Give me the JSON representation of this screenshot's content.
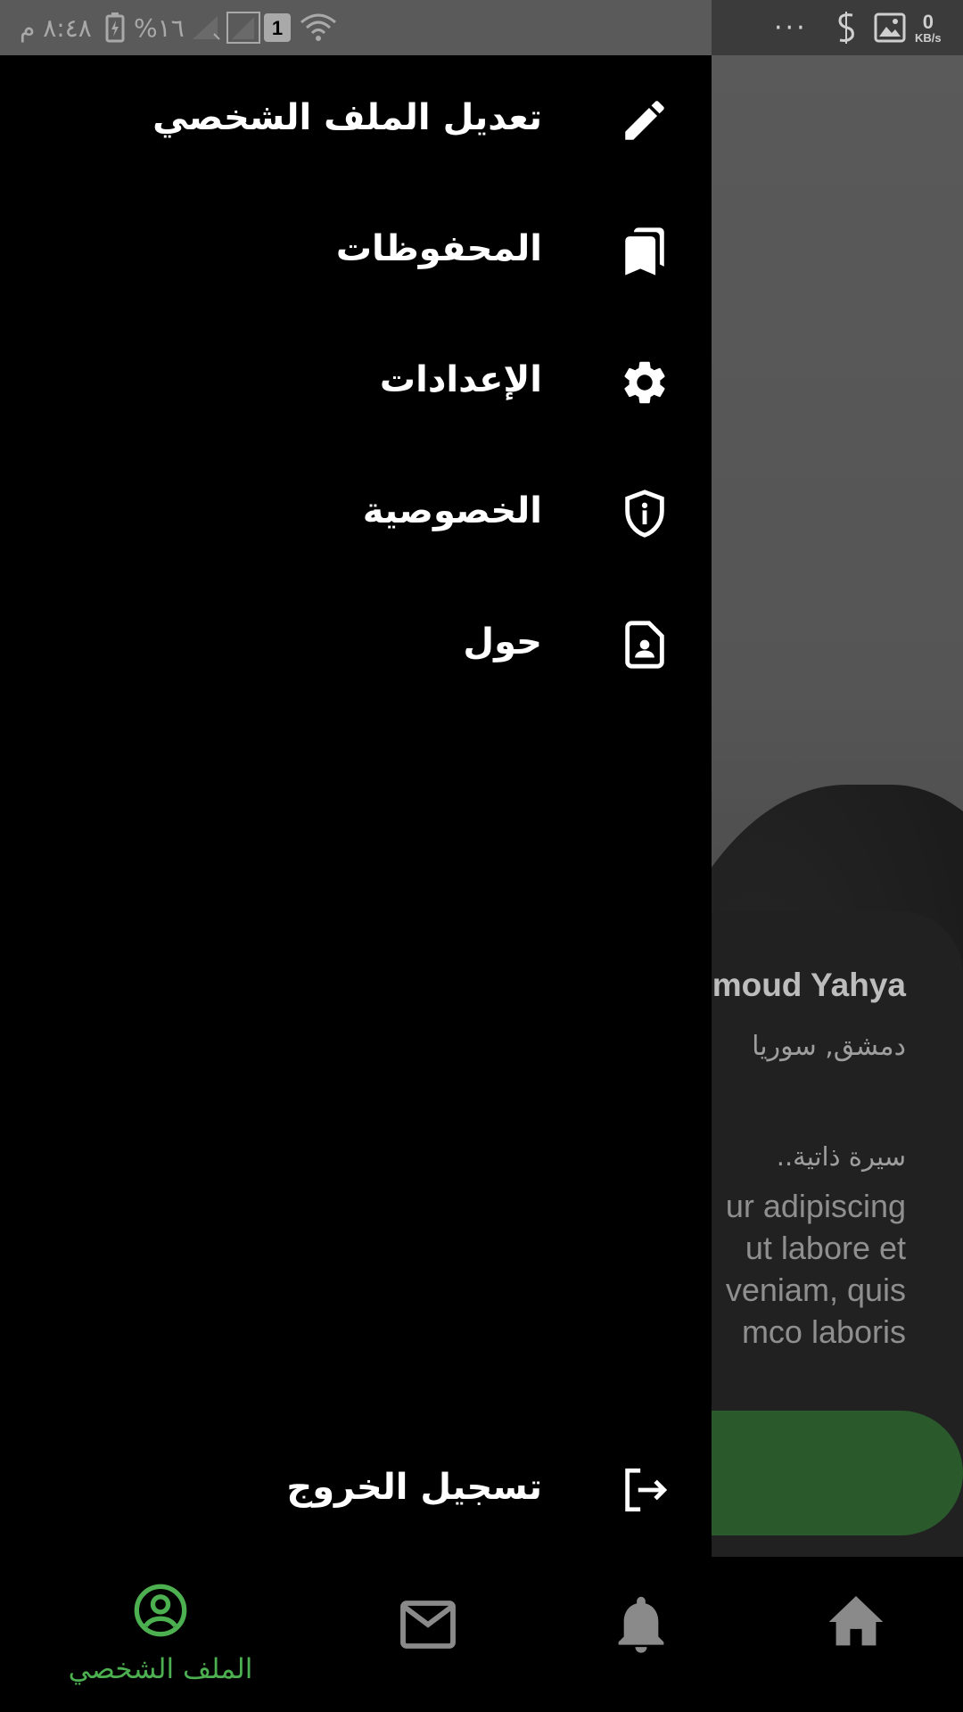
{
  "status_bar": {
    "time": "٨:٤٨ م",
    "battery_percent": "%١٦",
    "sim_slot": "1",
    "more": "···",
    "network_speed_value": "0",
    "network_speed_unit": "KB/s"
  },
  "drawer": {
    "items": [
      {
        "label": "تعديل الملف الشخصي",
        "icon": "pencil-icon"
      },
      {
        "label": "المحفوظات",
        "icon": "bookmarks-icon"
      },
      {
        "label": "الإعدادات",
        "icon": "gear-icon"
      },
      {
        "label": "الخصوصية",
        "icon": "shield-info-icon"
      },
      {
        "label": "حول",
        "icon": "contact-file-icon"
      }
    ],
    "logout": {
      "label": "تسجيل الخروج",
      "icon": "logout-icon"
    }
  },
  "background_profile": {
    "name_partial": "moud Yahya",
    "location": "دمشق, سوريا",
    "bio_title": "سيرة ذاتية..",
    "bio_lines": [
      "ur adipiscing",
      "ut labore et",
      "veniam, quis",
      "mco laboris"
    ]
  },
  "bottom_nav": {
    "items": [
      {
        "name": "profile",
        "label": "الملف الشخصي",
        "icon": "account-circle-icon",
        "active": true
      },
      {
        "name": "messages",
        "label": "",
        "icon": "mail-icon",
        "active": false
      },
      {
        "name": "notifications",
        "label": "",
        "icon": "bell-icon",
        "active": false
      },
      {
        "name": "home",
        "label": "",
        "icon": "home-icon",
        "active": false
      }
    ]
  },
  "colors": {
    "drawer_background": "#000000",
    "accent_green": "#4caf50",
    "inactive_icon": "#8a8a8a",
    "button_green": "#2a5a2c"
  }
}
